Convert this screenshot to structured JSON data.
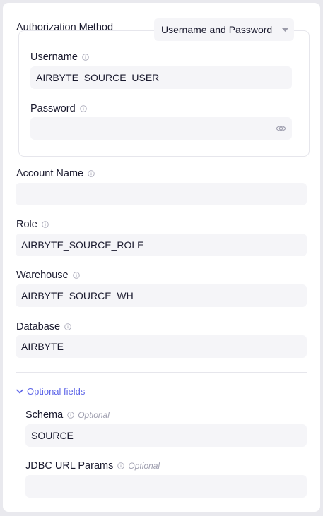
{
  "auth": {
    "method_label": "Authorization Method",
    "method_value": "Username and Password",
    "username_label": "Username",
    "username_value": "AIRBYTE_SOURCE_USER",
    "password_label": "Password",
    "password_value": ""
  },
  "fields": {
    "account_name_label": "Account Name",
    "account_name_value": "",
    "role_label": "Role",
    "role_value": "AIRBYTE_SOURCE_ROLE",
    "warehouse_label": "Warehouse",
    "warehouse_value": "AIRBYTE_SOURCE_WH",
    "database_label": "Database",
    "database_value": "AIRBYTE"
  },
  "optional": {
    "toggle_label": "Optional fields",
    "schema_label": "Schema",
    "schema_tag": "Optional",
    "schema_value": "SOURCE",
    "jdbc_label": "JDBC URL Params",
    "jdbc_tag": "Optional",
    "jdbc_value": ""
  },
  "colors": {
    "accent": "#5f67e8",
    "input_bg": "#f5f5f8",
    "border": "#e6e6ec",
    "muted": "#a0a0b0"
  }
}
